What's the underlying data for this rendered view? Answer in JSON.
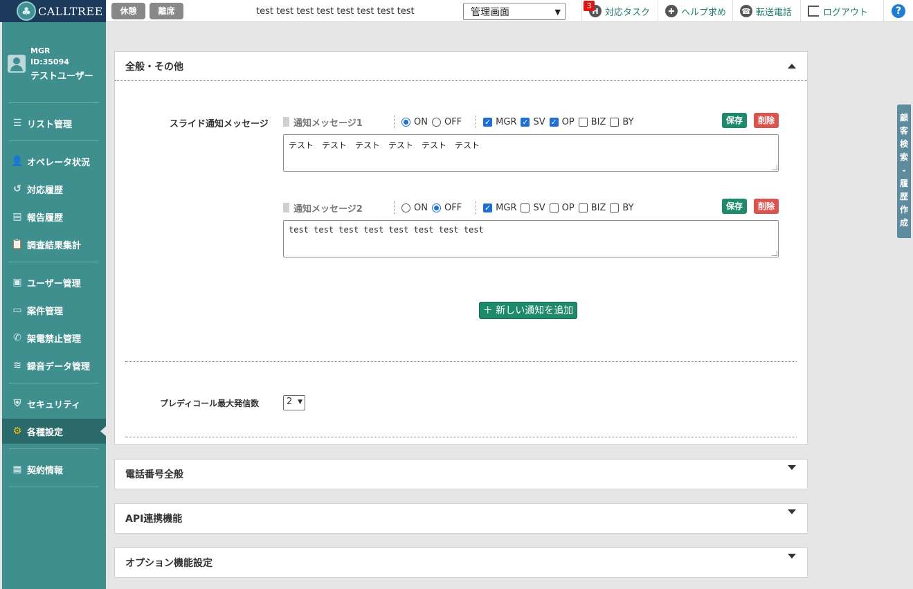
{
  "app": {
    "logo_text": "CALLTREE",
    "ticker": "test test test test test test test test"
  },
  "status_buttons": {
    "break_label": "休憩",
    "away_label": "離席"
  },
  "screen_select": {
    "value": "管理画面"
  },
  "top_nav": {
    "task_label": "対応タスク",
    "task_badge": "3",
    "help_label": "ヘルプ求め",
    "transfer_label": "転送電話",
    "logout_label": "ログアウト",
    "help_icon": "?"
  },
  "user": {
    "role": "MGR",
    "id": "ID:35094",
    "name": "テストユーザー"
  },
  "sidebar": {
    "items": [
      {
        "label": "リスト管理",
        "icon": "list-icon"
      },
      {
        "label": "オペレータ状況",
        "icon": "operator-icon"
      },
      {
        "label": "対応履歴",
        "icon": "history-icon"
      },
      {
        "label": "報告履歴",
        "icon": "report-icon"
      },
      {
        "label": "調査結果集計",
        "icon": "survey-icon"
      },
      {
        "label": "ユーザー管理",
        "icon": "user-card-icon"
      },
      {
        "label": "案件管理",
        "icon": "folder-icon"
      },
      {
        "label": "架電禁止管理",
        "icon": "phone-block-icon"
      },
      {
        "label": "録音データ管理",
        "icon": "audio-wave-icon"
      },
      {
        "label": "セキュリティ",
        "icon": "shield-icon"
      },
      {
        "label": "各種設定",
        "icon": "gear-icon",
        "active": true
      },
      {
        "label": "契約情報",
        "icon": "contract-icon"
      }
    ]
  },
  "general_panel": {
    "title": "全般・その他",
    "slide_label": "スライド通知メッセージ",
    "on_label": "ON",
    "off_label": "OFF",
    "roles": [
      "MGR",
      "SV",
      "OP",
      "BIZ",
      "BY"
    ],
    "save_label": "保存",
    "delete_label": "削除",
    "messages": [
      {
        "title": "通知メッセージ1",
        "status": "ON",
        "checked": [
          true,
          true,
          true,
          false,
          false
        ],
        "text": "テスト　テスト　テスト　テスト　テスト　テスト"
      },
      {
        "title": "通知メッセージ2",
        "status": "OFF",
        "checked": [
          true,
          false,
          false,
          false,
          false
        ],
        "text": "test test test test test test test test"
      }
    ],
    "add_button": "＋ 新しい通知を追加",
    "predictive_label": "プレディコール最大発信数",
    "predictive_value": "2"
  },
  "collapsed_panels": {
    "phone": "電話番号全般",
    "api": "API連携機能",
    "option": "オプション機能設定"
  },
  "side_tab": {
    "label": "顧客検索・履歴作成"
  },
  "colors": {
    "sidebar": "#3f8f8f",
    "sidebar_active": "#2b6a6a",
    "accent_green": "#1e8a6b",
    "delete_red": "#d9534f",
    "logo_bg": "#1b3a5c",
    "link_green": "#1e7d6d"
  }
}
